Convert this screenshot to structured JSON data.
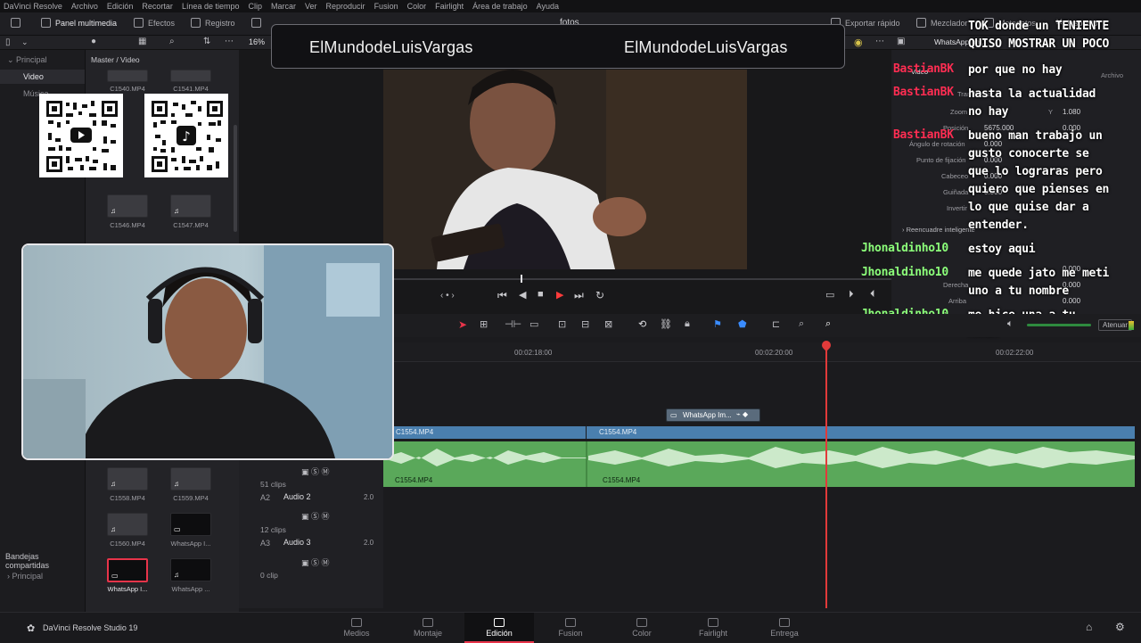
{
  "menu": [
    "DaVinci Resolve",
    "Archivo",
    "Edición",
    "Recortar",
    "Línea de tiempo",
    "Clip",
    "Marcar",
    "Ver",
    "Reproducir",
    "Fusion",
    "Color",
    "Fairlight",
    "Área de trabajo",
    "Ayuda"
  ],
  "toolbar": {
    "media_pool": "Panel multimedia",
    "effects": "Efectos",
    "index": "Registro",
    "project_title": "fotos",
    "quick_export": "Exportar rápido",
    "mixer": "Mezclador",
    "metadata": "Metadatos",
    "inspector": "Inspector"
  },
  "subbar": {
    "zoom": "16%",
    "clip_name": "WhatsApp Im..."
  },
  "sidebar": {
    "section": "Principal",
    "items": [
      "Video",
      "Música"
    ],
    "shared_bins": "Bandejas compartidas",
    "shared_item": "Principal"
  },
  "bin": {
    "path": "Master / Video",
    "clips": [
      {
        "name": "C1540.MP4"
      },
      {
        "name": "C1541.MP4"
      },
      {
        "name": "C1542.MP4"
      },
      {
        "name": "C1543.MP4"
      },
      {
        "name": "C1544.MP4"
      },
      {
        "name": "C1545.MP4"
      },
      {
        "name": "C1546.MP4"
      },
      {
        "name": "C1547.MP4"
      },
      {
        "name": "C1558.MP4"
      },
      {
        "name": "C1559.MP4"
      },
      {
        "name": "C1560.MP4"
      },
      {
        "name": "WhatsApp I..."
      },
      {
        "name": "WhatsApp I..."
      },
      {
        "name": "WhatsApp ..."
      }
    ]
  },
  "banner": {
    "left": "ElMundodeLuisVargas",
    "right": "ElMundodeLuisVargas"
  },
  "inspector": {
    "clip": "WhatsApp Im...",
    "tabs": [
      "Video",
      "Archivo"
    ],
    "rows": [
      {
        "label": "Transformar",
        "value": ""
      },
      {
        "label": "Zoom",
        "value": "1.080"
      },
      {
        "label": "Posición",
        "value": "5675.000"
      },
      {
        "label": "Ángulo de rotación",
        "value": "0.000"
      },
      {
        "label": "Punto de fijación",
        "value": "0.000"
      },
      {
        "label": "Cabeceo",
        "value": "0.000"
      },
      {
        "label": "Guiñada",
        "value": "0.000"
      },
      {
        "label": "Invertir",
        "value": ""
      }
    ],
    "pos_y": "0.000",
    "zoom_y_label": "Y",
    "reframe": "Reencuadre inteligente",
    "crop_right": "Derecha",
    "crop_top": "Arriba",
    "crop_right_val": "0.000",
    "crop_top_val": "0.000",
    "crop_val2": "0.000"
  },
  "chat": [
    {
      "user": "",
      "color": "#ffffff",
      "lines": [
        "TOK donde un TENIENTE",
        "QUISO MOSTRAR UN POCO"
      ]
    },
    {
      "user": "BastianBK",
      "color": "#ff2d52",
      "lines": [
        "por que no hay"
      ]
    },
    {
      "user": "BastianBK",
      "color": "#ff2d52",
      "lines": [
        "hasta la actualidad",
        "no hay"
      ]
    },
    {
      "user": "BastianBK",
      "color": "#ff2d52",
      "lines": [
        "bueno man trabajo un",
        "gusto conocerte se",
        "que lo lograras pero",
        "quiero que pienses en",
        "lo que quise dar a",
        "entender."
      ]
    },
    {
      "user": "Jhonaldinho10",
      "color": "#8cff7a",
      "lines": [
        "estoy aqui"
      ]
    },
    {
      "user": "Jhonaldinho10",
      "color": "#8cff7a",
      "lines": [
        "me quede jato me meti",
        "uno a tu nombre"
      ]
    },
    {
      "user": "Jhonaldinho10",
      "color": "#8cff7a",
      "lines": [
        "me hice una a tu",
        "nombr"
      ]
    }
  ],
  "timeline": {
    "ruler": [
      "00:02:18:00",
      "00:02:20:00",
      "00:02:22:00"
    ],
    "video_clips": [
      "C1554.MP4",
      "C1554.MP4"
    ],
    "title_clip": "WhatsApp Im...",
    "audio_clips": [
      "C1554.MP4",
      "C1554.MP4"
    ],
    "tracks": [
      {
        "id": "A2",
        "name": "Audio 2",
        "level": "2.0",
        "clips": "51 clips"
      },
      {
        "id": "A3",
        "name": "Audio 3",
        "level": "2.0",
        "clips": "12 clips"
      }
    ],
    "last_clips": "0 clip",
    "attenuate": "Atenuar"
  },
  "app": {
    "name": "DaVinci Resolve Studio 19"
  },
  "pages": [
    {
      "label": "Medios",
      "active": false
    },
    {
      "label": "Montaje",
      "active": false
    },
    {
      "label": "Edición",
      "active": true
    },
    {
      "label": "Fusion",
      "active": false
    },
    {
      "label": "Color",
      "active": false
    },
    {
      "label": "Fairlight",
      "active": false
    },
    {
      "label": "Entrega",
      "active": false
    }
  ],
  "colors": {
    "accent": "#e8344a",
    "video_clip": "#4a7fae",
    "audio_clip": "#5aa85a",
    "playhead": "#e23a3a"
  }
}
